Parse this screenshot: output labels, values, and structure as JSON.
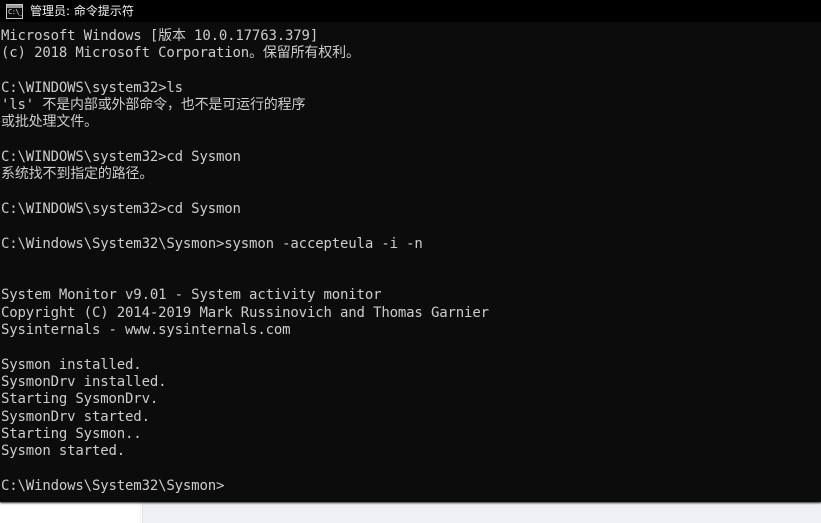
{
  "window": {
    "title": "管理员: 命令提示符",
    "icon": "cmd-console-icon",
    "icon_glyph": "C:\\_",
    "background_color": "#0c0c0c",
    "titlebar_color": "#000000",
    "text_color": "#cccccc"
  },
  "desktop": {
    "left_pane_color": "#ffffff",
    "right_pane_color": "#eef0f4"
  },
  "console": {
    "lines": [
      "Microsoft Windows [版本 10.0.17763.379]",
      "(c) 2018 Microsoft Corporation。保留所有权利。",
      "",
      "C:\\WINDOWS\\system32>ls",
      "'ls' 不是内部或外部命令，也不是可运行的程序",
      "或批处理文件。",
      "",
      "C:\\WINDOWS\\system32>cd Sysmon",
      "系统找不到指定的路径。",
      "",
      "C:\\WINDOWS\\system32>cd Sysmon",
      "",
      "C:\\Windows\\System32\\Sysmon>sysmon -accepteula -i -n",
      "",
      "",
      "System Monitor v9.01 - System activity monitor",
      "Copyright (C) 2014-2019 Mark Russinovich and Thomas Garnier",
      "Sysinternals - www.sysinternals.com",
      "",
      "Sysmon installed.",
      "SysmonDrv installed.",
      "Starting SysmonDrv.",
      "SysmonDrv started.",
      "Starting Sysmon..",
      "Sysmon started.",
      "",
      "C:\\Windows\\System32\\Sysmon>"
    ],
    "prompt_current": "C:\\Windows\\System32\\Sysmon>",
    "os_version": "10.0.17763.379",
    "copyright_year": "2018",
    "tool_name": "System Monitor",
    "tool_version": "v9.01",
    "tool_description": "System activity monitor",
    "tool_copyright": "Copyright (C) 2014-2019 Mark Russinovich and Thomas Garnier",
    "tool_vendor": "Sysinternals - www.sysinternals.com",
    "command_run": "sysmon -accepteula -i -n"
  }
}
